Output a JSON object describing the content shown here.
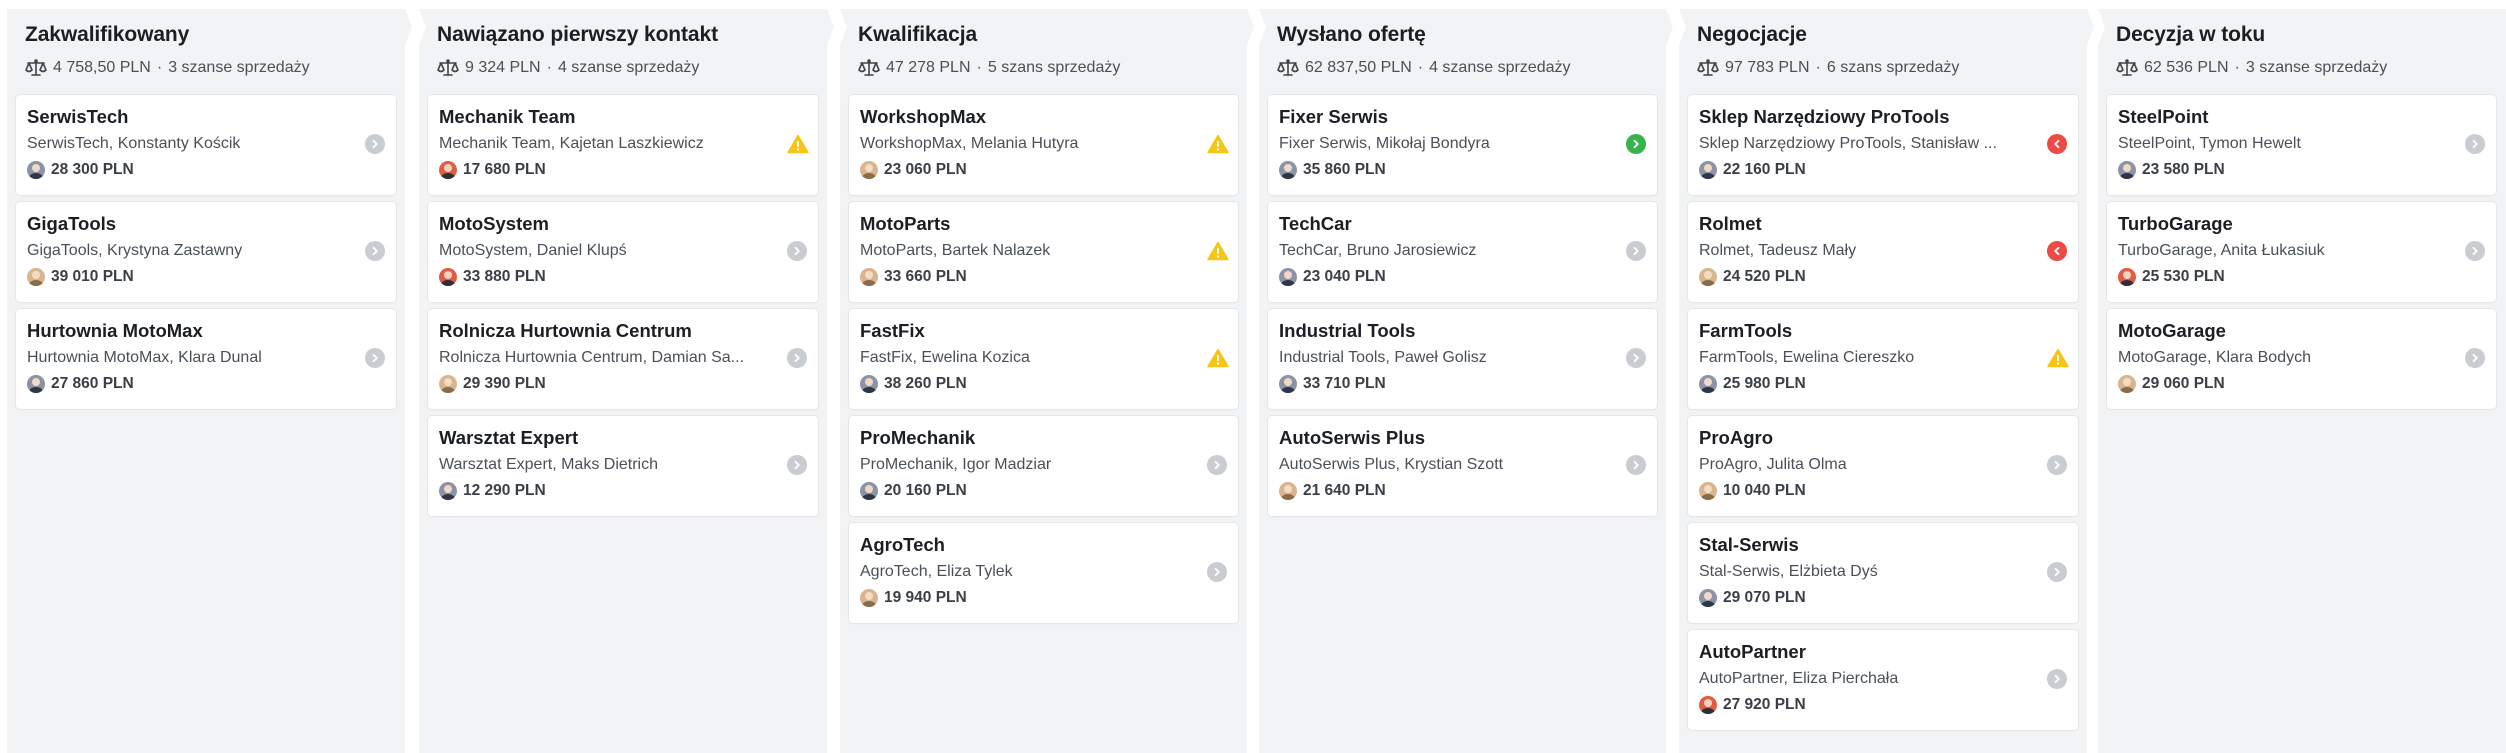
{
  "columns": [
    {
      "title": "Zakwalifikowany",
      "total": "4 758,50 PLN",
      "count": "3 szanse sprzedaży",
      "cards": [
        {
          "title": "SerwisTech",
          "contact": "SerwisTech, Konstanty Kościk",
          "amount": "28 300 PLN",
          "avatar": "gray",
          "status": "arrow-right-gray"
        },
        {
          "title": "GigaTools",
          "contact": "GigaTools, Krystyna Zastawny",
          "amount": "39 010 PLN",
          "avatar": "beige",
          "status": "arrow-right-gray"
        },
        {
          "title": "Hurtownia MotoMax",
          "contact": "Hurtownia MotoMax, Klara Dunal",
          "amount": "27 860 PLN",
          "avatar": "gray",
          "status": "arrow-right-gray"
        }
      ]
    },
    {
      "title": "Nawiązano pierwszy kontakt",
      "total": "9 324 PLN",
      "count": "4 szanse sprzedaży",
      "cards": [
        {
          "title": "Mechanik Team",
          "contact": "Mechanik Team, Kajetan Laszkiewicz",
          "amount": "17 680 PLN",
          "avatar": "red",
          "status": "warning-yellow"
        },
        {
          "title": "MotoSystem",
          "contact": "MotoSystem, Daniel Klupś",
          "amount": "33 880 PLN",
          "avatar": "red",
          "status": "arrow-right-gray"
        },
        {
          "title": "Rolnicza Hurtownia Centrum",
          "contact": "Rolnicza Hurtownia Centrum, Damian Sa...",
          "amount": "29 390 PLN",
          "avatar": "beige",
          "status": "arrow-right-gray"
        },
        {
          "title": "Warsztat Expert",
          "contact": "Warsztat Expert, Maks Dietrich",
          "amount": "12 290 PLN",
          "avatar": "gray",
          "status": "arrow-right-gray"
        }
      ]
    },
    {
      "title": "Kwalifikacja",
      "total": "47 278 PLN",
      "count": "5 szans sprzedaży",
      "cards": [
        {
          "title": "WorkshopMax",
          "contact": "WorkshopMax, Melania Hutyra",
          "amount": "23 060 PLN",
          "avatar": "beige",
          "status": "warning-yellow"
        },
        {
          "title": "MotoParts",
          "contact": "MotoParts, Bartek Nalazek",
          "amount": "33 660 PLN",
          "avatar": "beige",
          "status": "warning-yellow"
        },
        {
          "title": "FastFix",
          "contact": "FastFix, Ewelina Kozica",
          "amount": "38 260 PLN",
          "avatar": "gray",
          "status": "warning-yellow"
        },
        {
          "title": "ProMechanik",
          "contact": "ProMechanik, Igor Madziar",
          "amount": "20 160 PLN",
          "avatar": "gray",
          "status": "arrow-right-gray"
        },
        {
          "title": "AgroTech",
          "contact": "AgroTech, Eliza Tylek",
          "amount": "19 940 PLN",
          "avatar": "beige",
          "status": "arrow-right-gray"
        }
      ]
    },
    {
      "title": "Wysłano ofertę",
      "total": "62 837,50 PLN",
      "count": "4 szanse sprzedaży",
      "cards": [
        {
          "title": "Fixer Serwis",
          "contact": "Fixer Serwis, Mikołaj Bondyra",
          "amount": "35 860 PLN",
          "avatar": "gray",
          "status": "arrow-right-green"
        },
        {
          "title": "TechCar",
          "contact": "TechCar, Bruno Jarosiewicz",
          "amount": "23 040 PLN",
          "avatar": "gray",
          "status": "arrow-right-gray"
        },
        {
          "title": "Industrial Tools",
          "contact": "Industrial Tools, Paweł Golisz",
          "amount": "33 710 PLN",
          "avatar": "gray",
          "status": "arrow-right-gray"
        },
        {
          "title": "AutoSerwis Plus",
          "contact": "AutoSerwis Plus, Krystian Szott",
          "amount": "21 640 PLN",
          "avatar": "beige",
          "status": "arrow-right-gray"
        }
      ]
    },
    {
      "title": "Negocjacje",
      "total": "97 783 PLN",
      "count": "6 szans sprzedaży",
      "cards": [
        {
          "title": "Sklep Narzędziowy ProTools",
          "contact": "Sklep Narzędziowy ProTools, Stanisław ...",
          "amount": "22 160 PLN",
          "avatar": "gray",
          "status": "arrow-left-red"
        },
        {
          "title": "Rolmet",
          "contact": "Rolmet, Tadeusz Mały",
          "amount": "24 520 PLN",
          "avatar": "beige",
          "status": "arrow-left-red"
        },
        {
          "title": "FarmTools",
          "contact": "FarmTools, Ewelina Ciereszko",
          "amount": "25 980 PLN",
          "avatar": "gray",
          "status": "warning-yellow"
        },
        {
          "title": "ProAgro",
          "contact": "ProAgro, Julita Olma",
          "amount": "10 040 PLN",
          "avatar": "beige",
          "status": "arrow-right-gray"
        },
        {
          "title": "Stal-Serwis",
          "contact": "Stal-Serwis, Elżbieta Dyś",
          "amount": "29 070 PLN",
          "avatar": "gray",
          "status": "arrow-right-gray"
        },
        {
          "title": "AutoPartner",
          "contact": "AutoPartner, Eliza Pierchała",
          "amount": "27 920 PLN",
          "avatar": "red",
          "status": "arrow-right-gray"
        }
      ]
    },
    {
      "title": "Decyzja w toku",
      "total": "62 536 PLN",
      "count": "3 szanse sprzedaży",
      "cards": [
        {
          "title": "SteelPoint",
          "contact": "SteelPoint, Tymon Hewelt",
          "amount": "23 580 PLN",
          "avatar": "gray",
          "status": "arrow-right-gray"
        },
        {
          "title": "TurboGarage",
          "contact": "TurboGarage, Anita Łukasiuk",
          "amount": "25 530 PLN",
          "avatar": "red",
          "status": "arrow-right-gray"
        },
        {
          "title": "MotoGarage",
          "contact": "MotoGarage, Klara Bodych",
          "amount": "29 060 PLN",
          "avatar": "beige",
          "status": "arrow-right-gray"
        }
      ]
    }
  ],
  "colors": {
    "column_bg": "#f2f3f4",
    "status_gray": "#c9ccd1",
    "status_green": "#37b24d",
    "status_red": "#ee4a45",
    "status_warning": "#f5c518"
  },
  "icons": {
    "column_header": "scale-icon",
    "card_owner": "avatar",
    "card_status": [
      "arrow-right-gray",
      "arrow-right-green",
      "arrow-left-red",
      "warning-yellow"
    ]
  }
}
